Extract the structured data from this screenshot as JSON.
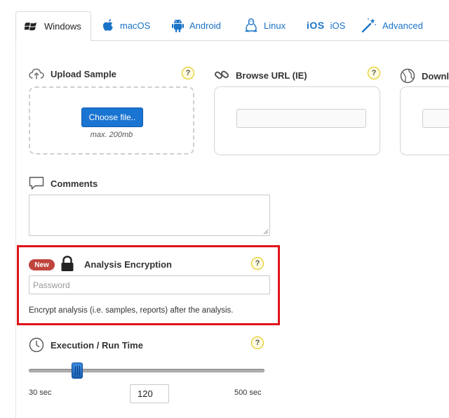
{
  "tabs": [
    {
      "label": "Windows",
      "icon": "windows-icon",
      "active": true
    },
    {
      "label": "macOS",
      "icon": "apple-icon",
      "active": false
    },
    {
      "label": "Android",
      "icon": "android-icon",
      "active": false
    },
    {
      "label": "Linux",
      "icon": "linux-icon",
      "active": false
    },
    {
      "label": "iOS",
      "icon_text": "iOS",
      "icon": "ios-icon",
      "active": false
    },
    {
      "label": "Advanced",
      "icon": "magic-wand-icon",
      "active": false
    }
  ],
  "upload": {
    "title": "Upload Sample",
    "button": "Choose file..",
    "max": "max. 200mb",
    "help": "?"
  },
  "browse": {
    "title": "Browse URL (IE)",
    "help": "?"
  },
  "download": {
    "title": "Downl"
  },
  "comments": {
    "title": "Comments"
  },
  "encryption": {
    "badge": "New",
    "title": "Analysis Encryption",
    "help": "?",
    "password_placeholder": "Password",
    "description": "Encrypt analysis (i.e. samples, reports) after the analysis."
  },
  "runtime": {
    "title": "Execution / Run Time",
    "help": "?",
    "min_label": "30 sec",
    "max_label": "500 sec",
    "value": "120",
    "slider_fraction": 0.19
  },
  "colors": {
    "accent": "#1a73c7",
    "button": "#1a74d2",
    "highlight": "#e0131b",
    "badge": "#c0453e"
  }
}
